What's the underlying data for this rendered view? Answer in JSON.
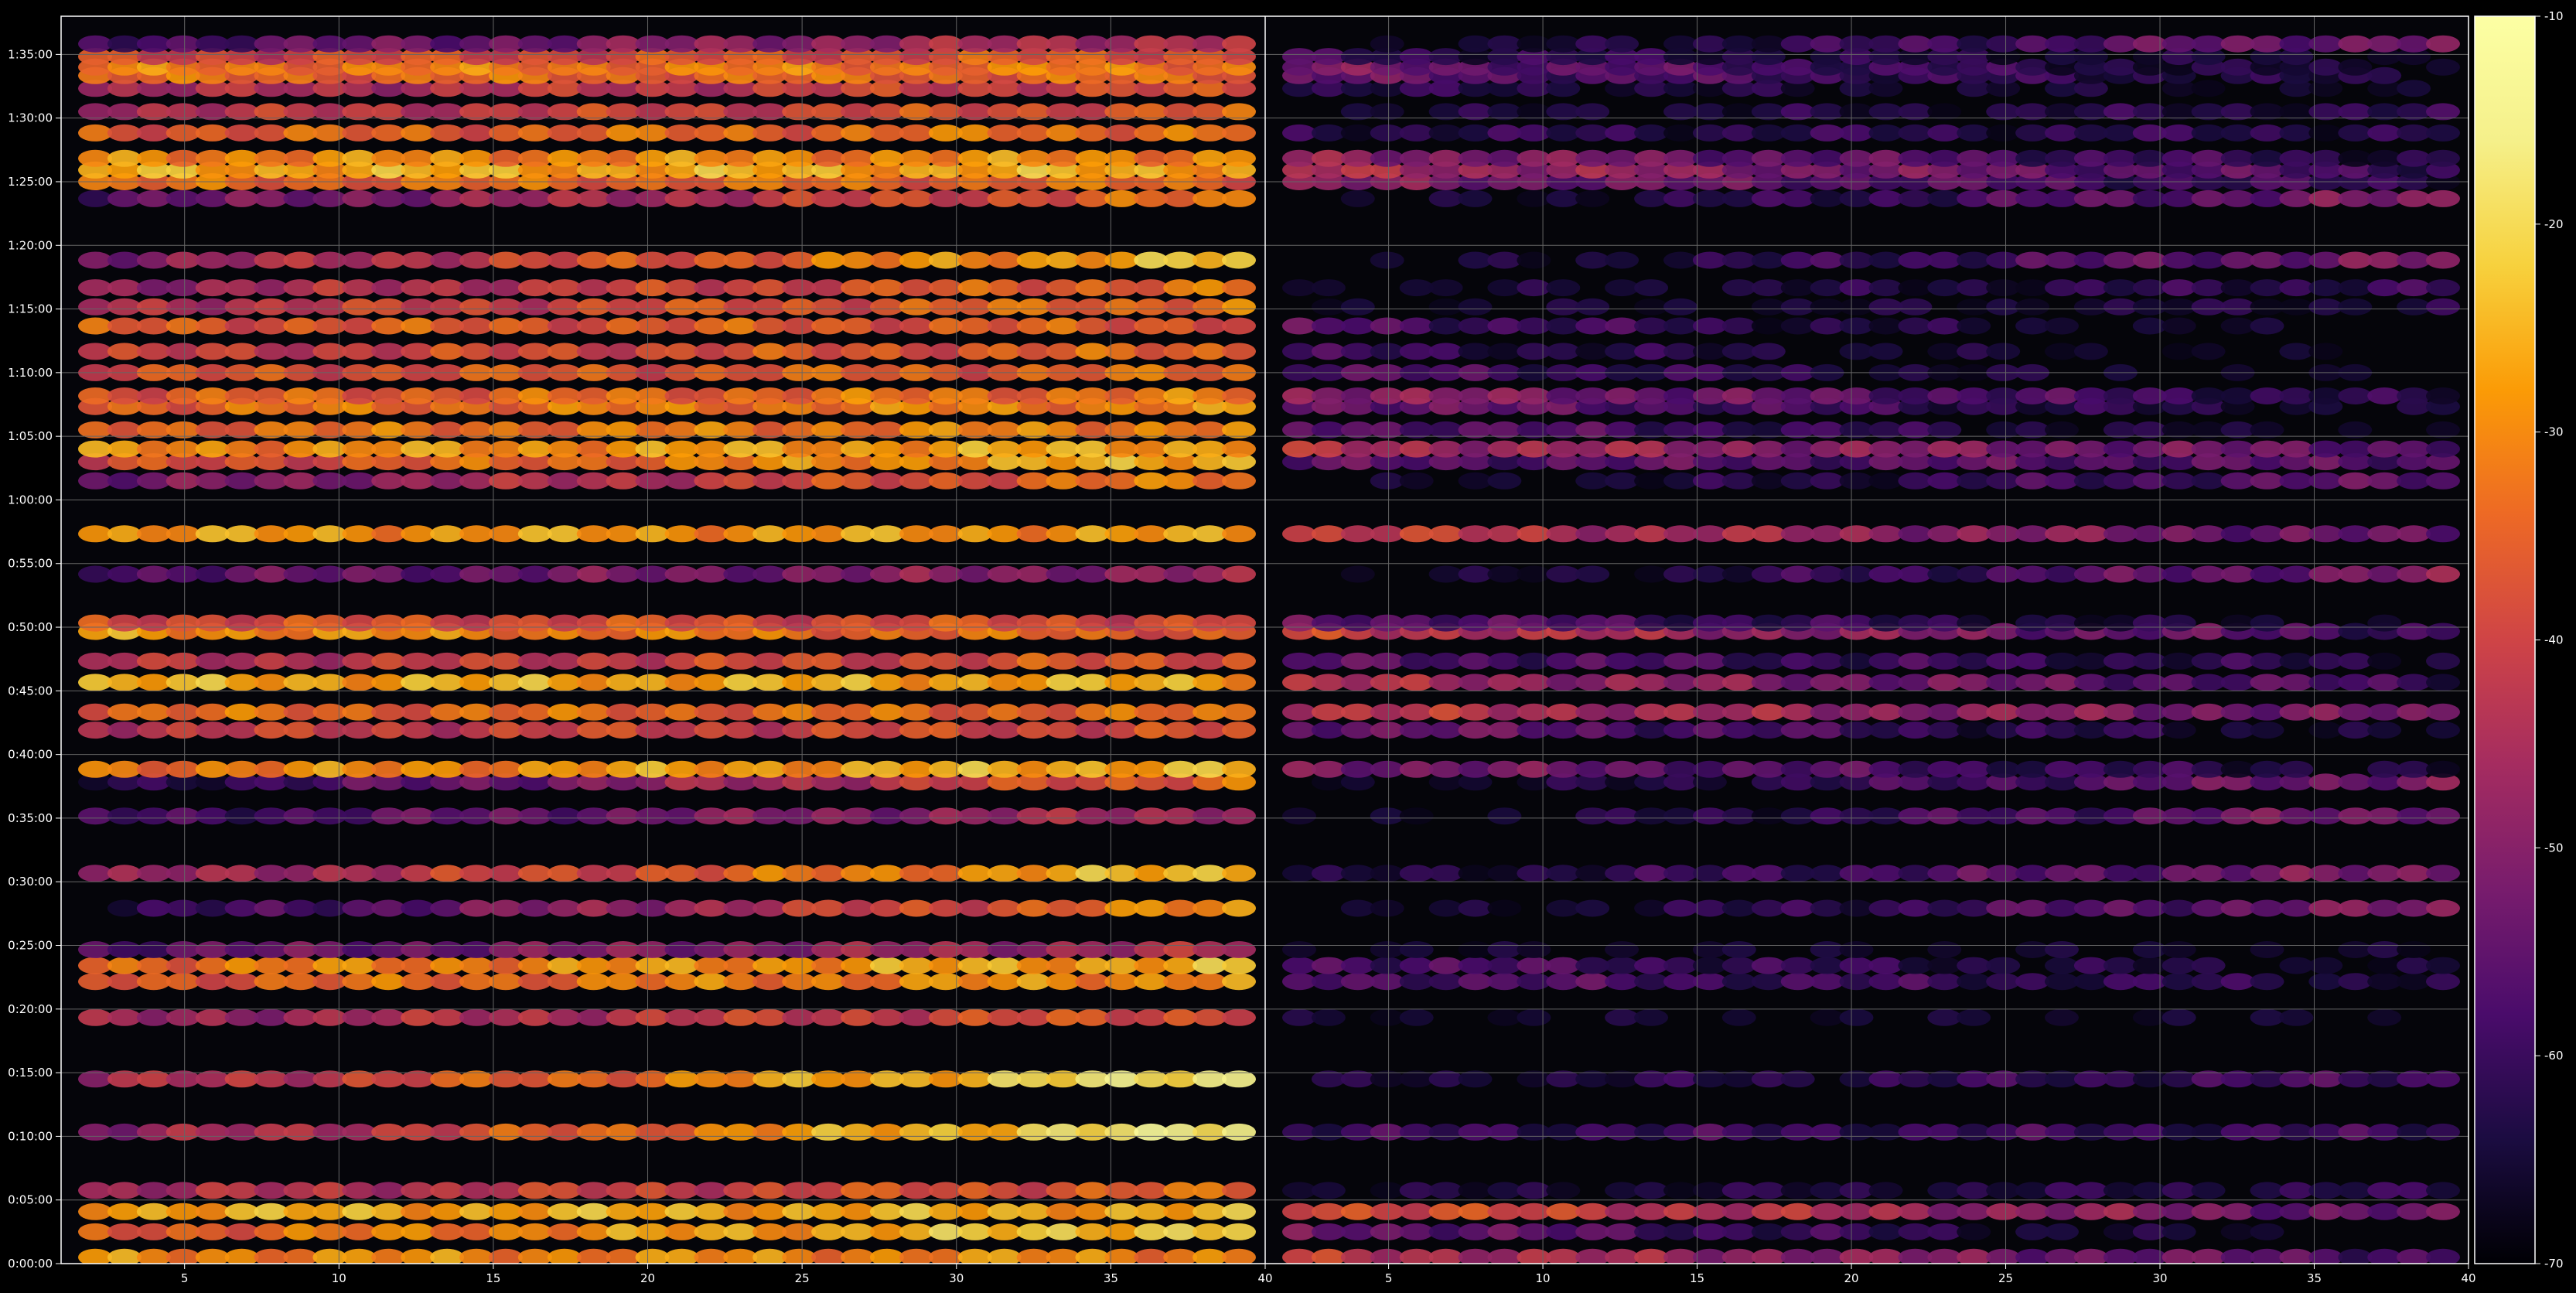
{
  "chart_data": {
    "type": "heatmap",
    "title": "",
    "xlabel": "",
    "ylabel": "",
    "panels": [
      {
        "name": "",
        "xlim": [
          1,
          40
        ]
      },
      {
        "name": "",
        "xlim": [
          1,
          40
        ]
      }
    ],
    "x_ticks": [
      5,
      10,
      15,
      20,
      25,
      30,
      35,
      40
    ],
    "ylim_seconds": [
      0,
      5880
    ],
    "y_tick_labels": [
      "0:00:00",
      "0:05:00",
      "0:10:00",
      "0:15:00",
      "0:20:00",
      "0:25:00",
      "0:30:00",
      "0:35:00",
      "0:40:00",
      "0:45:00",
      "0:50:00",
      "0:55:00",
      "1:00:00",
      "1:05:00",
      "1:10:00",
      "1:15:00",
      "1:20:00",
      "1:25:00",
      "1:30:00",
      "1:35:00"
    ],
    "colorbar": {
      "colormap": "inferno",
      "range": [
        -70,
        -10
      ],
      "tick_labels": [
        "-10",
        "-20",
        "-30",
        "-40",
        "-50",
        "-60",
        "-70"
      ]
    },
    "grid": true,
    "background": "#000000",
    "grid_color": "#666666",
    "bands": [
      {
        "t_seconds": 30,
        "left_level": -30,
        "right_level": -42,
        "left_trend": 0.0,
        "right_trend": -0.4
      },
      {
        "t_seconds": 150,
        "left_level": -36,
        "right_level": -52,
        "left_trend": 0.4,
        "right_trend": -0.5
      },
      {
        "t_seconds": 245,
        "left_level": -26,
        "right_level": -36,
        "left_trend": 0.0,
        "right_trend": -0.5
      },
      {
        "t_seconds": 345,
        "left_level": -46,
        "right_level": -66,
        "left_trend": 0.3,
        "right_trend": 0.1
      },
      {
        "t_seconds": 620,
        "left_level": -50,
        "right_level": -60,
        "left_trend": 0.9,
        "right_trend": 0.0
      },
      {
        "t_seconds": 870,
        "left_level": -47,
        "right_level": -66,
        "left_trend": 0.8,
        "right_trend": 0.2
      },
      {
        "t_seconds": 1160,
        "left_level": -48,
        "right_level": -68,
        "left_trend": 0.3,
        "right_trend": 0.0
      },
      {
        "t_seconds": 1330,
        "left_level": -36,
        "right_level": -56,
        "left_trend": 0.2,
        "right_trend": -0.2
      },
      {
        "t_seconds": 1405,
        "left_level": -33,
        "right_level": -56,
        "left_trend": 0.2,
        "right_trend": -0.3
      },
      {
        "t_seconds": 1480,
        "left_level": -56,
        "right_level": -68,
        "left_trend": 0.3,
        "right_trend": 0.0
      },
      {
        "t_seconds": 1675,
        "left_level": -64,
        "right_level": -70,
        "left_trend": 0.9,
        "right_trend": 0.5
      },
      {
        "t_seconds": 1840,
        "left_level": -50,
        "right_level": -66,
        "left_trend": 0.7,
        "right_trend": 0.4
      },
      {
        "t_seconds": 2110,
        "left_level": -60,
        "right_level": -70,
        "left_trend": 0.4,
        "right_trend": 0.5
      },
      {
        "t_seconds": 2270,
        "left_level": -64,
        "right_level": -70,
        "left_trend": 0.8,
        "right_trend": 0.5
      },
      {
        "t_seconds": 2330,
        "left_level": -32,
        "right_level": -50,
        "left_trend": 0.2,
        "right_trend": -0.4
      },
      {
        "t_seconds": 2515,
        "left_level": -42,
        "right_level": -52,
        "left_trend": 0.1,
        "right_trend": -0.4
      },
      {
        "t_seconds": 2600,
        "left_level": -34,
        "right_level": -42,
        "left_trend": 0.0,
        "right_trend": -0.3
      },
      {
        "t_seconds": 2740,
        "left_level": -26,
        "right_level": -44,
        "left_trend": 0.0,
        "right_trend": -0.4
      },
      {
        "t_seconds": 2840,
        "left_level": -44,
        "right_level": -56,
        "left_trend": 0.2,
        "right_trend": -0.2
      },
      {
        "t_seconds": 2980,
        "left_level": -28,
        "right_level": -40,
        "left_trend": -0.2,
        "right_trend": -0.5
      },
      {
        "t_seconds": 3020,
        "left_level": -38,
        "right_level": -54,
        "left_trend": 0.0,
        "right_trend": -0.4
      },
      {
        "t_seconds": 3250,
        "left_level": -56,
        "right_level": -70,
        "left_trend": 0.2,
        "right_trend": 0.5
      },
      {
        "t_seconds": 3440,
        "left_level": -28,
        "right_level": -40,
        "left_trend": 0.0,
        "right_trend": -0.4
      },
      {
        "t_seconds": 3690,
        "left_level": -54,
        "right_level": -70,
        "left_trend": 0.6,
        "right_trend": 0.4
      },
      {
        "t_seconds": 3780,
        "left_level": -40,
        "right_level": -56,
        "left_trend": 0.4,
        "right_trend": 0.0
      },
      {
        "t_seconds": 3840,
        "left_level": -30,
        "right_level": -44,
        "left_trend": 0.1,
        "right_trend": -0.3
      },
      {
        "t_seconds": 3930,
        "left_level": -34,
        "right_level": -54,
        "left_trend": 0.1,
        "right_trend": -0.4
      },
      {
        "t_seconds": 4040,
        "left_level": -34,
        "right_level": -52,
        "left_trend": 0.1,
        "right_trend": -0.4
      },
      {
        "t_seconds": 4090,
        "left_level": -36,
        "right_level": -48,
        "left_trend": 0.1,
        "right_trend": -0.4
      },
      {
        "t_seconds": 4200,
        "left_level": -38,
        "right_level": -56,
        "left_trend": 0.1,
        "right_trend": -0.4
      },
      {
        "t_seconds": 4300,
        "left_level": -42,
        "right_level": -60,
        "left_trend": 0.2,
        "right_trend": -0.3
      },
      {
        "t_seconds": 4420,
        "left_level": -36,
        "right_level": -56,
        "left_trend": 0.0,
        "right_trend": -0.4
      },
      {
        "t_seconds": 4510,
        "left_level": -44,
        "right_level": -68,
        "left_trend": 0.3,
        "right_trend": 0.1
      },
      {
        "t_seconds": 4600,
        "left_level": -48,
        "right_level": -68,
        "left_trend": 0.4,
        "right_trend": 0.2
      },
      {
        "t_seconds": 4730,
        "left_level": -50,
        "right_level": -70,
        "left_trend": 0.7,
        "right_trend": 0.5
      },
      {
        "t_seconds": 5020,
        "left_level": -56,
        "right_level": -70,
        "left_trend": 0.6,
        "right_trend": 0.5
      },
      {
        "t_seconds": 5100,
        "left_level": -34,
        "right_level": -50,
        "left_trend": 0.0,
        "right_trend": -0.3
      },
      {
        "t_seconds": 5155,
        "left_level": -26,
        "right_level": -44,
        "left_trend": 0.0,
        "right_trend": -0.4
      },
      {
        "t_seconds": 5210,
        "left_level": -30,
        "right_level": -48,
        "left_trend": 0.0,
        "right_trend": -0.4
      },
      {
        "t_seconds": 5330,
        "left_level": -36,
        "right_level": -62,
        "left_trend": 0.1,
        "right_trend": 0.0
      },
      {
        "t_seconds": 5430,
        "left_level": -44,
        "right_level": -66,
        "left_trend": 0.2,
        "right_trend": 0.1
      },
      {
        "t_seconds": 5540,
        "left_level": -46,
        "right_level": -62,
        "left_trend": 0.2,
        "right_trend": -0.2
      },
      {
        "t_seconds": 5600,
        "left_level": -34,
        "right_level": -54,
        "left_trend": 0.0,
        "right_trend": -0.3
      },
      {
        "t_seconds": 5640,
        "left_level": -32,
        "right_level": -52,
        "left_trend": 0.0,
        "right_trend": -0.4
      },
      {
        "t_seconds": 5690,
        "left_level": -40,
        "right_level": -60,
        "left_trend": 0.1,
        "right_trend": -0.2
      },
      {
        "t_seconds": 5750,
        "left_level": -58,
        "right_level": -70,
        "left_trend": 0.4,
        "right_trend": 0.5
      }
    ]
  }
}
